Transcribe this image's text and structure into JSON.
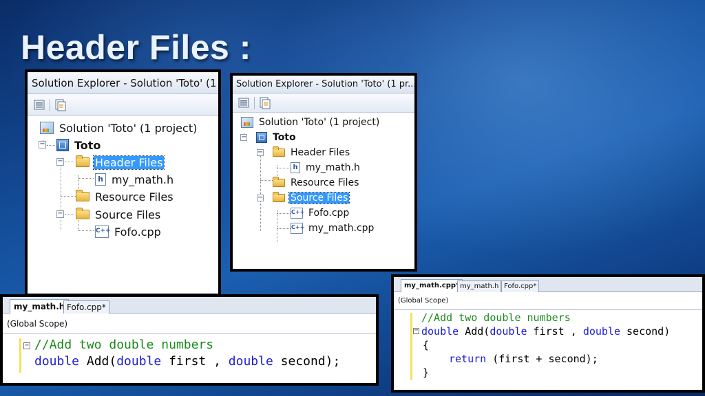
{
  "slide": {
    "title": "Header Files :"
  },
  "explorer_left": {
    "title": "Solution Explorer - Solution 'Toto' (1",
    "solution": "Solution 'Toto' (1 project)",
    "project": "Toto",
    "header_folder": "Header Files",
    "header_file": "my_math.h",
    "resource_folder": "Resource Files",
    "source_folder": "Source Files",
    "source_file": "Fofo.cpp",
    "selected": "Header Files"
  },
  "explorer_right": {
    "title": "Solution Explorer - Solution 'Toto' (1 pr...",
    "solution": "Solution 'Toto' (1 project)",
    "project": "Toto",
    "header_folder": "Header Files",
    "header_file": "my_math.h",
    "resource_folder": "Resource Files",
    "source_folder": "Source Files",
    "source_file_1": "Fofo.cpp",
    "source_file_2": "my_math.cpp",
    "selected": "Source Files"
  },
  "editor_header": {
    "tabs": [
      "my_math.h",
      "Fofo.cpp*"
    ],
    "active_tab": "my_math.h",
    "scope": "(Global Scope)",
    "line1_comment": "//Add two double numbers",
    "line2": {
      "kw1": "double",
      "t1": " Add(",
      "kw2": "double",
      "t2": " first , ",
      "kw3": "double",
      "t3": " second);"
    }
  },
  "editor_cpp": {
    "tabs": [
      "my_math.cpp*",
      "my_math.h",
      "Fofo.cpp*"
    ],
    "active_tab": "my_math.cpp*",
    "scope": "(Global Scope)",
    "line1_comment": "//Add two double numbers",
    "line2": {
      "kw1": "double",
      "t1": " Add(",
      "kw2": "double",
      "t2": " first , ",
      "kw3": "double",
      "t3": " second)"
    },
    "line3": "{",
    "line4": {
      "kw": "return",
      "t": " (first + second);"
    },
    "line5": "}"
  },
  "icons": {
    "solution": "solution-icon",
    "project": "project-icon",
    "folder": "folder-icon",
    "header_file": "header-file-icon",
    "cpp_file": "cpp-file-icon"
  },
  "colors": {
    "selection": "#3399ff",
    "keyword": "#1c1cd8",
    "comment": "#1a8a1a"
  }
}
